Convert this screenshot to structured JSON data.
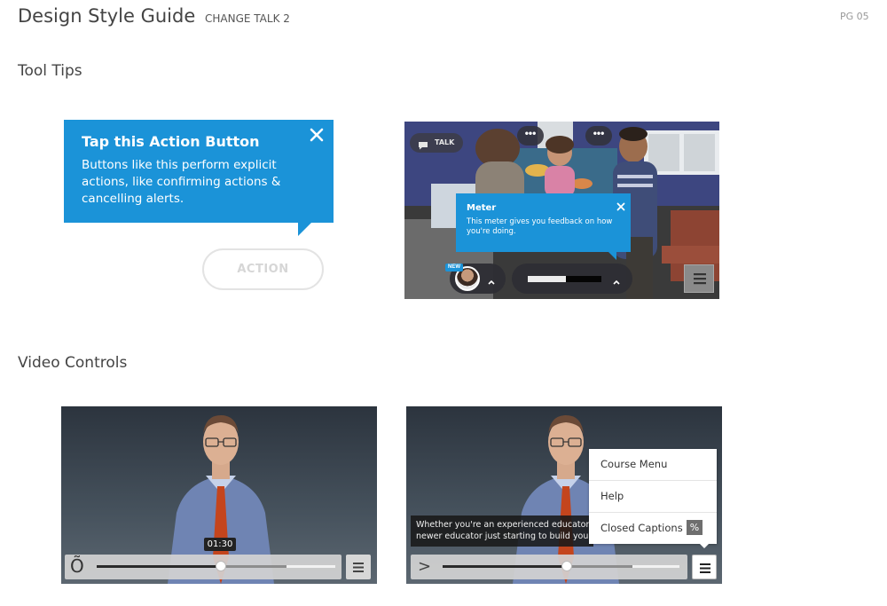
{
  "header": {
    "title": "Design Style Guide",
    "subtitle": "CHANGE TALK 2",
    "page_number": "PG 05"
  },
  "tooltips_section": {
    "heading": "Tool Tips",
    "large_tooltip": {
      "title": "Tap this Action Button",
      "body": "Buttons like this perform explicit actions, like confirming actions & cancelling alerts.",
      "close_icon": "close-icon"
    },
    "action_button_label": "ACTION",
    "scene": {
      "talk_label": "TALK",
      "dots": "•••",
      "meter_tooltip": {
        "title": "Meter",
        "body": "This meter gives you feedback on how you're doing."
      },
      "new_badge": "NEW",
      "meter_value_fraction": 0.5
    }
  },
  "video_section": {
    "heading": "Video Controls",
    "player1": {
      "play_glyph": "Õ",
      "time_tooltip": "01:30",
      "progress_fraction": 0.5,
      "buffer_fraction": 0.8
    },
    "player2": {
      "play_glyph": ">",
      "caption_text": "Whether you're an experienced educator lookin newer educator just starting to build your skills,",
      "caption_line1": "Whether you're an experienced educator lookin",
      "caption_line2": "newer educator just starting to build your skills,",
      "progress_fraction": 0.5,
      "buffer_fraction": 0.8,
      "menu": {
        "items": [
          {
            "label": "Course Menu"
          },
          {
            "label": "Help"
          },
          {
            "label": "Closed Captions"
          }
        ],
        "cc_badge": "%"
      }
    }
  },
  "colors": {
    "accent_blue": "#1b93d8",
    "dark_bar": "#2d2d34"
  }
}
